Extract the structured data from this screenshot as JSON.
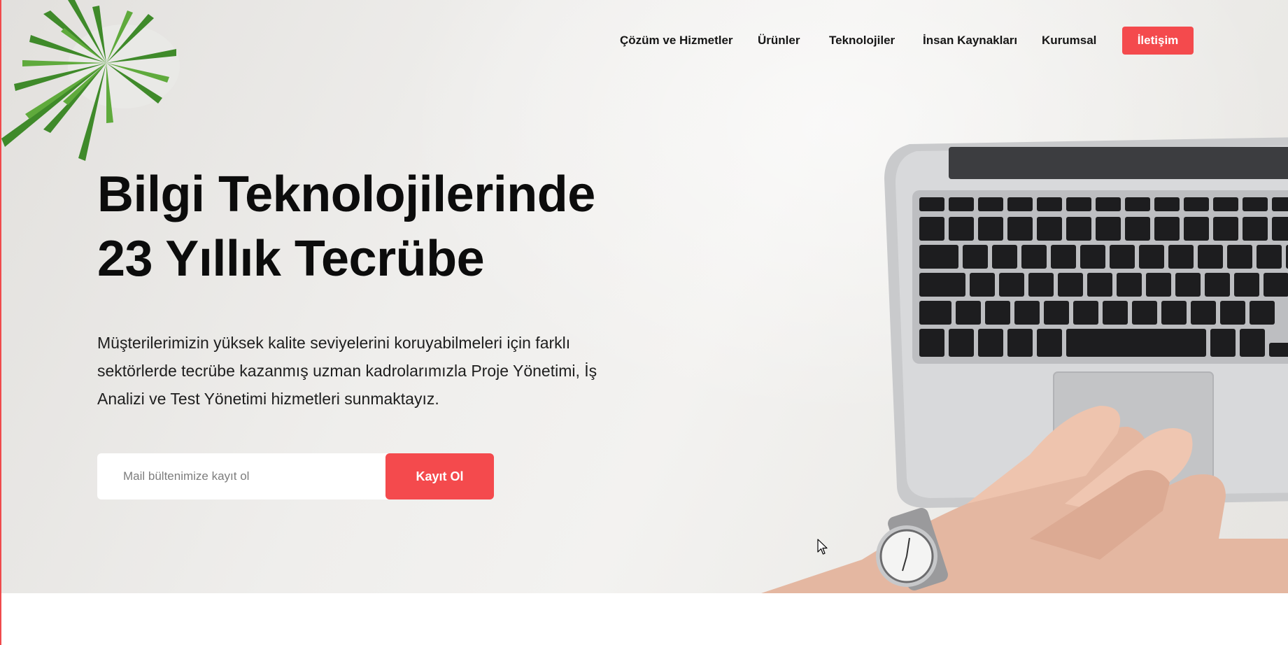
{
  "nav": {
    "items": [
      {
        "label": "Çözüm ve Hizmetler"
      },
      {
        "label": "Ürünler"
      },
      {
        "label": "Teknolojiler"
      },
      {
        "label": "İnsan Kaynakları"
      },
      {
        "label": "Kurumsal"
      }
    ],
    "cta_label": "İletişim"
  },
  "hero": {
    "headline_line1": "Bilgi Teknolojilerinde",
    "headline_line2": "23 Yıllık Tecrübe",
    "description": "Müşterilerimizin yüksek kalite seviyelerini koruyabilmeleri için farklı sektörlerde tecrübe kazanmış uzman kadrolarımızla Proje Yönetimi, İş Analizi ve Test Yönetimi hizmetleri sunmaktayız."
  },
  "newsletter": {
    "placeholder": "Mail bültenimize kayıt ol",
    "value": "",
    "button_label": "Kayıt Ol"
  },
  "colors": {
    "accent": "#f44a4d",
    "text": "#0c0c0c",
    "background": "#efeeec"
  },
  "icons": {
    "cursor": "mouse-pointer-icon"
  }
}
